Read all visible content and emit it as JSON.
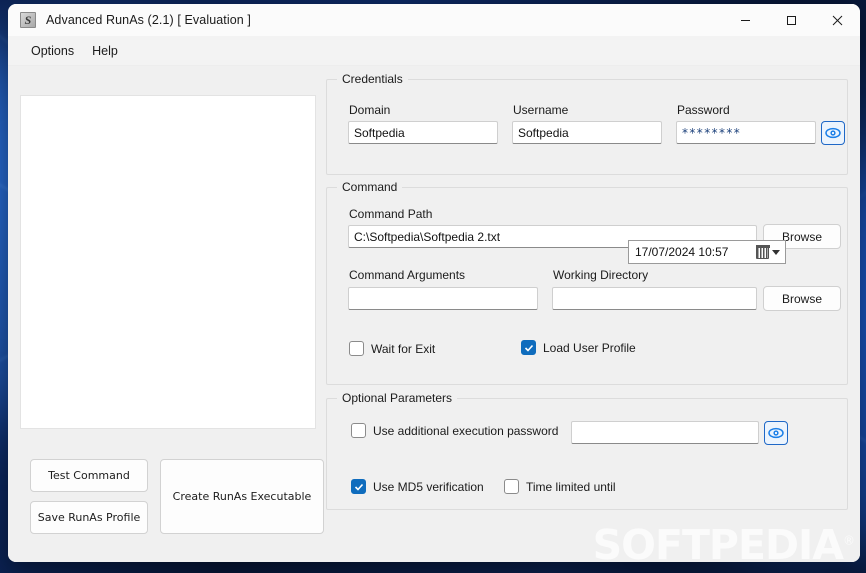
{
  "window": {
    "title": "Advanced RunAs (2.1) [ Evaluation ]",
    "app_icon": "app-s-icon",
    "controls": {
      "minimize": "minimize-icon",
      "maximize": "maximize-icon",
      "close": "close-icon"
    }
  },
  "menubar": {
    "items": [
      {
        "label": "Options"
      },
      {
        "label": "Help"
      }
    ]
  },
  "left_panel": {
    "listbox_items": [],
    "buttons": {
      "test_command": "Test Command",
      "save_profile": "Save RunAs Profile",
      "create_executable": "Create RunAs Executable"
    }
  },
  "credentials": {
    "legend": "Credentials",
    "domain": {
      "label": "Domain",
      "value": "Softpedia",
      "placeholder": ""
    },
    "username": {
      "label": "Username",
      "value": "Softpedia",
      "placeholder": ""
    },
    "password": {
      "label": "Password",
      "value": "********",
      "placeholder": ""
    },
    "reveal_icon": "eye-icon"
  },
  "command": {
    "legend": "Command",
    "command_path": {
      "label": "Command Path",
      "value": "C:\\Softpedia\\Softpedia 2.txt",
      "placeholder": "",
      "browse_label": "Browse"
    },
    "command_arguments": {
      "label": "Command Arguments",
      "value": "",
      "placeholder": ""
    },
    "working_directory": {
      "label": "Working Directory",
      "value": "",
      "placeholder": "",
      "browse_label": "Browse"
    },
    "wait_for_exit": {
      "label": "Wait for Exit",
      "checked": false
    },
    "load_user_profile": {
      "label": "Load User Profile",
      "checked": true
    }
  },
  "optional_parameters": {
    "legend": "Optional Parameters",
    "additional_password": {
      "label": "Use additional execution password",
      "checked": false,
      "value": "",
      "placeholder": "",
      "reveal_icon": "eye-icon"
    },
    "md5_verification": {
      "label": "Use MD5 verification",
      "checked": true
    },
    "time_limited": {
      "label": "Time limited until",
      "checked": false
    },
    "datetime": {
      "value": "17/07/2024 10:57",
      "calendar_icon": "calendar-icon",
      "dropdown_icon": "chevron-down-icon"
    }
  },
  "watermark": {
    "text": "SOFTPEDIA"
  },
  "colors": {
    "accent": "#0f6cbd",
    "eye_blue": "#1f68c7",
    "window_bg": "#f0f0f0",
    "titlebar_bg": "#fbfbfb",
    "close_hover": "#c42b1c"
  }
}
